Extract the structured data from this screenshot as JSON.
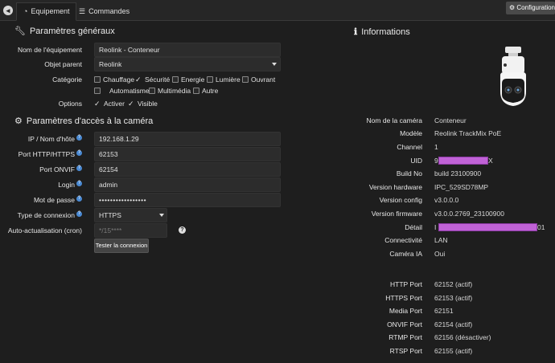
{
  "topbar": {
    "tabs": [
      {
        "label": "Equipement",
        "active": true
      },
      {
        "label": "Commandes",
        "active": false
      }
    ],
    "config_button": "Configuration a"
  },
  "general": {
    "title": "Paramètres généraux",
    "nom_label": "Nom de l'équipement",
    "nom_value": "Reolink - Conteneur",
    "parent_label": "Objet parent",
    "parent_value": "Reolink",
    "categorie_label": "Catégorie",
    "categories": [
      {
        "label": "Chauffage",
        "checked": false
      },
      {
        "label": "Sécurité",
        "checked": true
      },
      {
        "label": "Energie",
        "checked": false
      },
      {
        "label": "Lumière",
        "checked": false
      },
      {
        "label": "Ouvrant",
        "checked": false
      },
      {
        "label": "Automatisme",
        "checked": false
      },
      {
        "label": "Multimédia",
        "checked": false
      },
      {
        "label": "Autre",
        "checked": false
      }
    ],
    "options_label": "Options",
    "options": [
      {
        "label": "Activer",
        "checked": true
      },
      {
        "label": "Visible",
        "checked": true
      }
    ]
  },
  "camera_access": {
    "title": "Paramètres d'accès à la caméra",
    "ip_label": "IP / Nom d'hôte",
    "ip_value": "192.168.1.29",
    "http_label": "Port HTTP/HTTPS",
    "http_value": "62153",
    "onvif_label": "Port ONVIF",
    "onvif_value": "62154",
    "login_label": "Login",
    "login_value": "admin",
    "password_label": "Mot de passe",
    "password_value": "•••••••••••••••••",
    "conn_label": "Type de connexion",
    "conn_value": "HTTPS",
    "cron_label": "Auto-actualisation (cron)",
    "cron_placeholder": "*/15****",
    "test_button": "Tester la connexion"
  },
  "informations": {
    "title": "Informations",
    "rows": [
      {
        "label": "Nom de la caméra",
        "value": "Conteneur"
      },
      {
        "label": "Modèle",
        "value": "Reolink TrackMix PoE"
      },
      {
        "label": "Channel",
        "value": "1"
      },
      {
        "label": "UID",
        "value": "9",
        "suffix": "X"
      },
      {
        "label": "Build No",
        "value": "build 23100900"
      },
      {
        "label": "Version hardware",
        "value": "IPC_529SD78MP"
      },
      {
        "label": "Version config",
        "value": "v3.0.0.0"
      },
      {
        "label": "Version firmware",
        "value": "v3.0.0.2769_23100900"
      },
      {
        "label": "Détail",
        "value": "I",
        "suffix": "01"
      },
      {
        "label": "Connectivité",
        "value": "LAN"
      },
      {
        "label": "Caméra IA",
        "value": "Oui"
      }
    ],
    "ports": [
      {
        "label": "HTTP Port",
        "value": "62152 (actif)"
      },
      {
        "label": "HTTPS Port",
        "value": "62153 (actif)"
      },
      {
        "label": "Media Port",
        "value": "62151"
      },
      {
        "label": "ONVIF Port",
        "value": "62154 (actif)"
      },
      {
        "label": "RTMP Port",
        "value": "62156 (désactiver)"
      },
      {
        "label": "RTSP Port",
        "value": "62155 (actif)"
      }
    ]
  }
}
